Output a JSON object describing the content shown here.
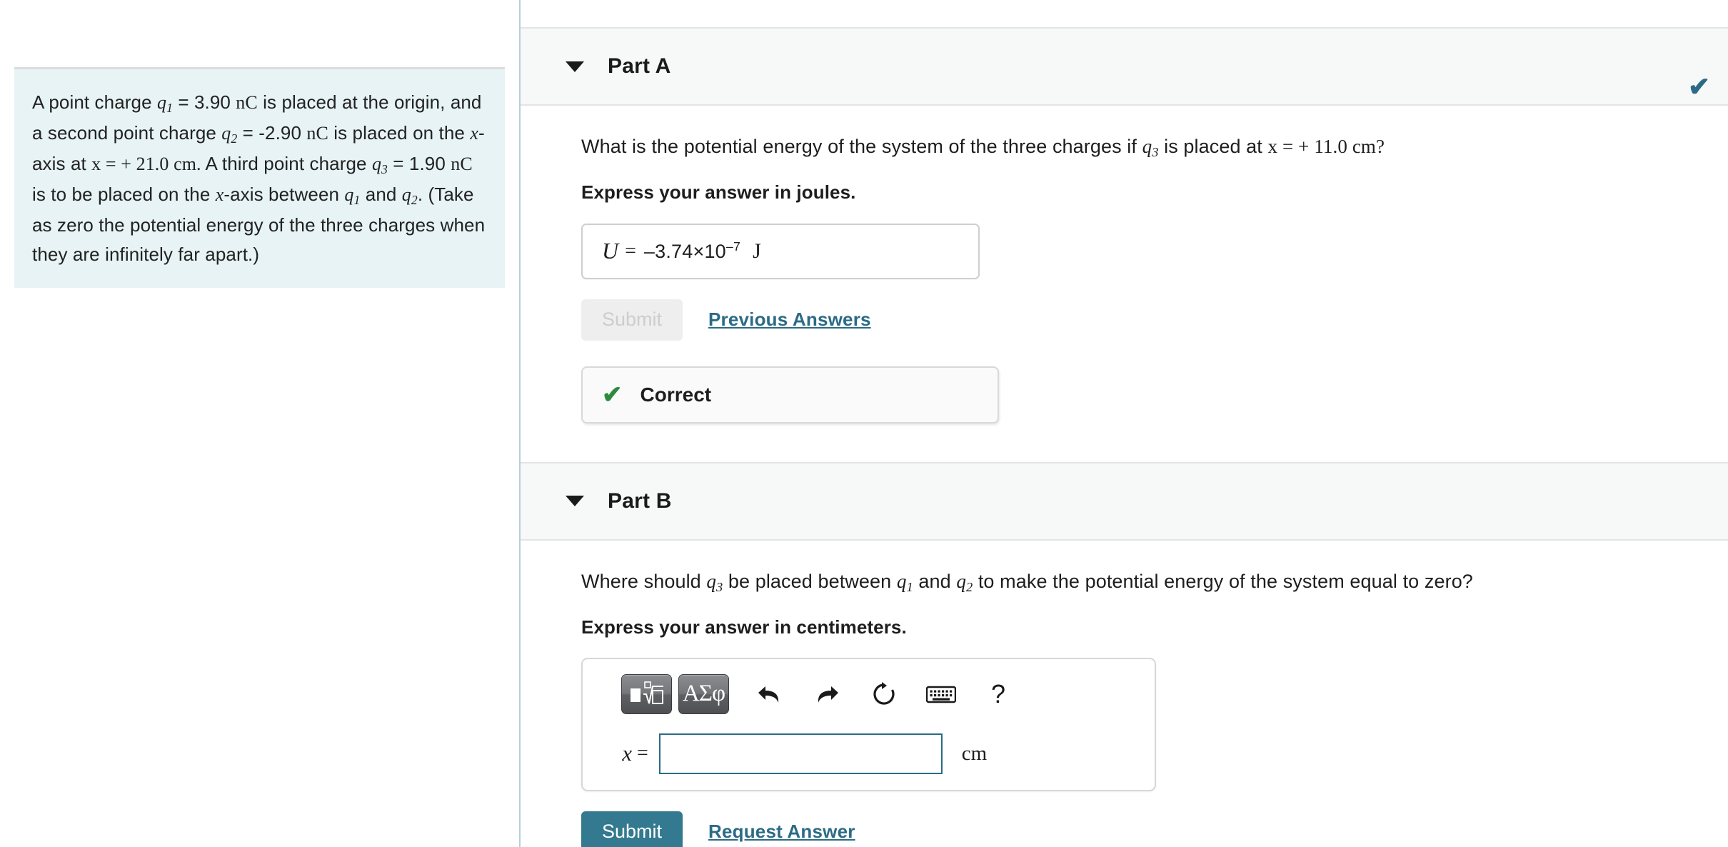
{
  "problem": {
    "line1_a": "A point charge ",
    "q1": "q",
    "q1_sub": "1",
    "line1_b": " = 3.90 ",
    "unit_nC": "nC",
    "line1_c": " is placed at the origin,",
    "line2_a": "and a second point charge ",
    "q2": "q",
    "q2_sub": "2",
    "line2_b": " = -2.90 ",
    "line2_c": " is placed on",
    "line3_a": "the ",
    "x_var": "x",
    "line3_b": "-axis at ",
    "line3_eq": "x = + 21.0 cm.",
    "line3_c": " A third point charge",
    "q3": "q",
    "q3_sub": "3",
    "line4_b": " = 1.90 ",
    "line4_c": " is to be placed on the ",
    "line4_d": "-axis between",
    "line5_a": " and ",
    "line5_b": ". (Take as zero the potential energy of the",
    "line6": "three charges when they are infinitely far apart.)"
  },
  "partA": {
    "title": "Part A",
    "caret_icon": "caret-down-icon",
    "status_check_icon": "check-icon",
    "question_pre": "What is the potential energy of the system of the three charges if ",
    "question_q": "q",
    "question_q_sub": "3",
    "question_mid": " is placed at ",
    "question_math": "x = + 11.0 cm?",
    "express": "Express your answer in joules.",
    "answer": {
      "lhs": "U",
      "eq": "=",
      "mantissa": "–3.74×10",
      "exponent": "–7",
      "unit": "J"
    },
    "submit_label": "Submit",
    "submit_disabled": true,
    "previous_answers_label": "Previous Answers",
    "feedback": {
      "icon": "check-icon",
      "label": "Correct"
    }
  },
  "partB": {
    "title": "Part B",
    "caret_icon": "caret-down-icon",
    "question_pre": "Where should ",
    "question_q3": "q",
    "question_q3_sub": "3",
    "question_mid1": " be placed between ",
    "question_q1": "q",
    "question_q1_sub": "1",
    "question_mid2": " and ",
    "question_q2": "q",
    "question_q2_sub": "2",
    "question_post": " to make the potential energy of the system equal to zero?",
    "express": "Express your answer in centimeters.",
    "toolbar": {
      "template_button": "math-template-button",
      "greek_button_label": "ΑΣφ",
      "undo_icon": "undo-arrow-icon",
      "redo_icon": "redo-arrow-icon",
      "reset_icon": "reset-circular-arrow-icon",
      "keyboard_icon": "keyboard-icon",
      "help_label": "?"
    },
    "entry": {
      "lhs": "x",
      "eq": "=",
      "value": "",
      "placeholder": "",
      "unit": "cm"
    },
    "submit_label": "Submit",
    "request_answer_label": "Request Answer"
  },
  "colors": {
    "accent_teal": "#33798f",
    "link_teal": "#2b6b86",
    "correct_green": "#2e8b3d",
    "problem_card_bg": "#e7f3f5",
    "panel_header_bg": "#f7f8f8"
  }
}
